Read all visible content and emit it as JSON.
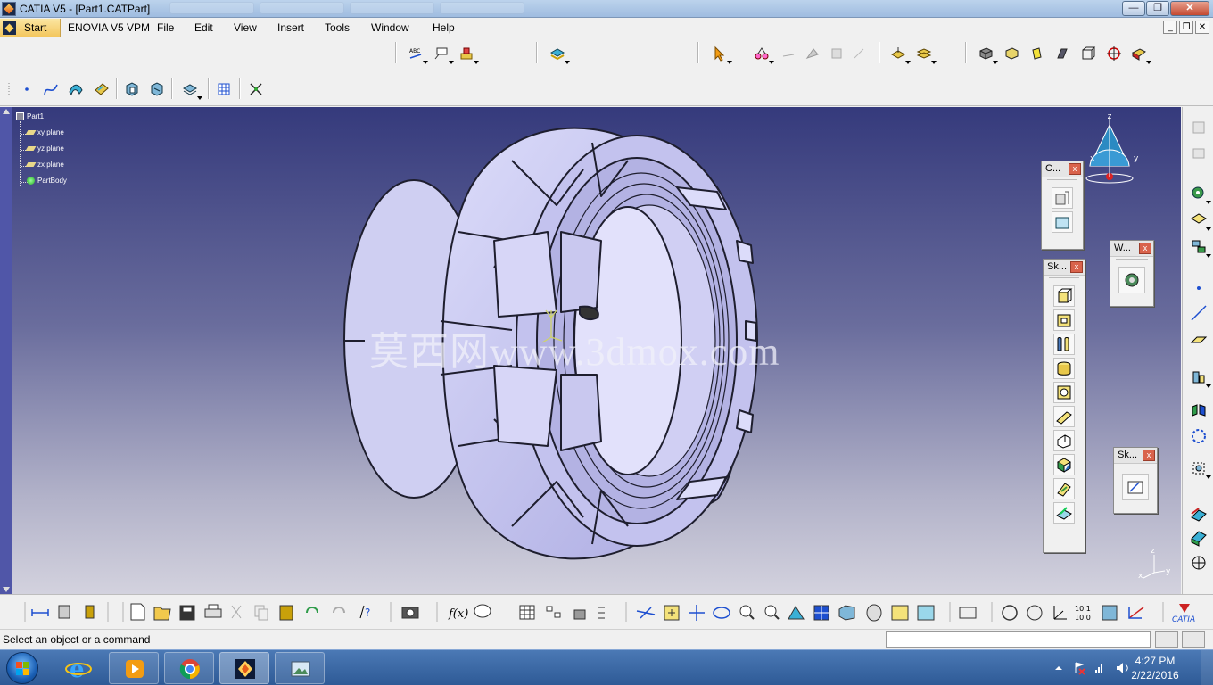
{
  "window": {
    "title": "CATIA V5 - [Part1.CATPart]",
    "min_glyph": "—",
    "max_glyph": "❐",
    "close_glyph": "✕"
  },
  "menu": {
    "start": "Start",
    "items": [
      "ENOVIA V5 VPM",
      "File",
      "Edit",
      "View",
      "Insert",
      "Tools",
      "Window",
      "Help"
    ],
    "mdi_min": "_",
    "mdi_restore": "❐",
    "mdi_close": "✕"
  },
  "tree": {
    "root": "Part1",
    "planes": [
      "xy plane",
      "yz plane",
      "zx plane"
    ],
    "body": "PartBody"
  },
  "viewport": {
    "watermark": "莫西网www.3dmox.com",
    "compass_z": "z",
    "compass_x": "x",
    "compass_y": "y",
    "axis_z": "z",
    "axis_x": "x",
    "axis_y": "y"
  },
  "palettes": {
    "constraints_title": "C...",
    "sketch_based_title": "Sk...",
    "workbench_title": "W...",
    "sketcher_title": "Sk...",
    "close_glyph": "x"
  },
  "status": {
    "message": "Select an object or a command"
  },
  "taskbar": {
    "time": "4:27 PM",
    "date": "2/22/2016"
  },
  "colors": {
    "viewport_top": "#353a7c",
    "viewport_bottom": "#d3d2de",
    "part_fill": "#c9c8f0",
    "part_edge": "#1e1e2e",
    "taskbar": "#2e5a96"
  }
}
